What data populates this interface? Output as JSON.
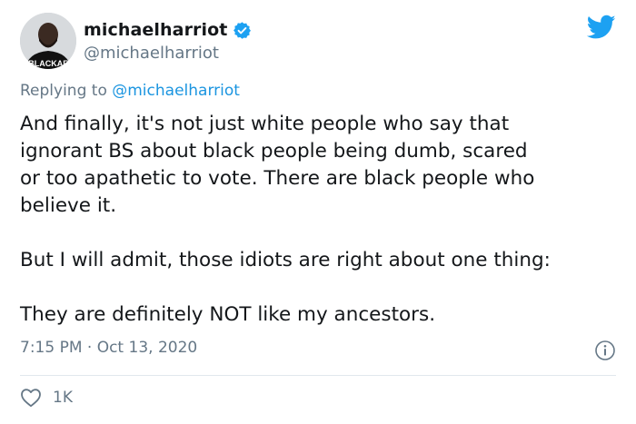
{
  "author": {
    "display_name": "michaelharriot",
    "handle": "@michaelharriot",
    "verified": true,
    "avatar_badge": "BLACKAF"
  },
  "reply": {
    "prefix": "Replying to ",
    "mention": "@michaelharriot"
  },
  "tweet": {
    "text": "And finally, it's not just white people who say that\nignorant BS about black people being dumb, scared\nor too apathetic to vote. There are black people who\nbelieve it.\n\nBut I will admit, those idiots are right about one thing:\n\nThey are definitely NOT like my ancestors.",
    "timestamp": "7:15 PM · Oct 13, 2020"
  },
  "engagement": {
    "likes": "1K"
  },
  "icons": {
    "platform": "twitter-bird-icon",
    "verified": "verified-badge-icon",
    "info": "info-icon",
    "like": "heart-icon"
  },
  "colors": {
    "brand_blue": "#1da1f2",
    "link_blue": "#1b95e0",
    "secondary_text": "#657786",
    "primary_text": "#14171a"
  }
}
